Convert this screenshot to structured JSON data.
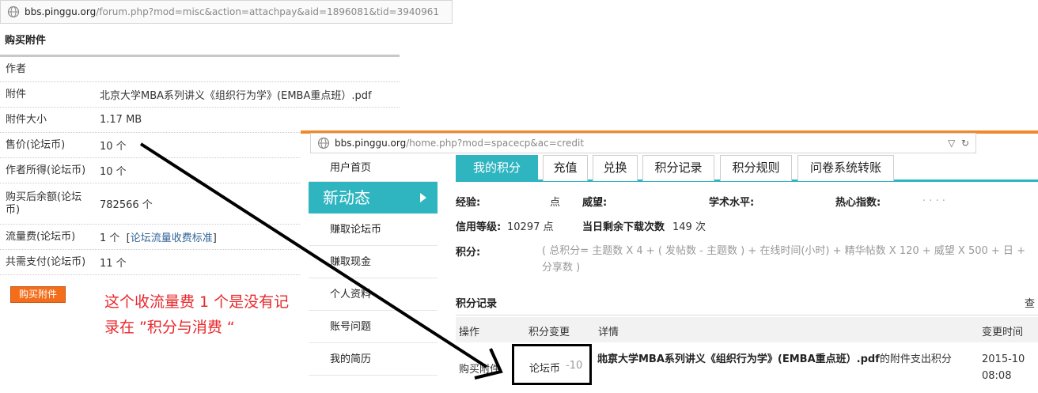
{
  "left_window": {
    "url": {
      "host": "bbs.pinggu.org",
      "path": "/forum.php?mod=misc&action=attachpay&aid=1896081&tid=3940961"
    },
    "title": "购买附件",
    "rows": [
      {
        "label": "作者",
        "value": ""
      },
      {
        "label": "附件",
        "value": "北京大学MBA系列讲义《组织行为学》(EMBA重点班）.pdf"
      },
      {
        "label": "附件大小",
        "value": "1.17 MB"
      },
      {
        "label": "售价(论坛币)",
        "value": "10 个"
      },
      {
        "label": "作者所得(论坛币)",
        "value": "10 个"
      },
      {
        "label": "购买后余额(论坛币)",
        "value": "782566 个"
      },
      {
        "label": "流量费(论坛币)",
        "value": "1 个",
        "link_text": "论坛流量收费标准"
      },
      {
        "label": "共需支付(论坛币)",
        "value": "11 个"
      }
    ],
    "buy_button": "购买附件",
    "annotation": "这个收流量费 1 个是没有记录在 ”积分与消费 “"
  },
  "right_window": {
    "url": {
      "host": "bbs.pinggu.org",
      "path": "/home.php?mod=spacecp&ac=credit"
    },
    "sidebar": [
      "用户首页",
      "新动态",
      "赚取论坛币",
      "赚取现金",
      "个人资料",
      "账号问题",
      "我的简历"
    ],
    "sidebar_active": "新动态",
    "tabs": [
      "我的积分",
      "充值",
      "兑换",
      "积分记录",
      "积分规则",
      "问卷系统转账"
    ],
    "tab_active": "我的积分",
    "stats": {
      "exp_label": "经验:",
      "exp_unit": "点",
      "prestige_label": "威望:",
      "academic_label": "学术水平:",
      "enthusiasm_label": "热心指数:",
      "credit_level_label": "信用等级:",
      "credit_level_value": "10297 点",
      "downloads_label": "当日剩余下载次数",
      "downloads_value": "149 次",
      "points_label": "积分:",
      "points_formula": "( 总积分= 主题数 X 4 + ( 发帖数 - 主题数 ) + 在线时间(小时) + 精华帖数 X 120 + 威望 X 500 + 日 + 分享数 )"
    },
    "records": {
      "title": "积分记录",
      "more": "查",
      "columns": [
        "操作",
        "积分变更",
        "详情",
        "变更时间"
      ],
      "rows": [
        {
          "action": "购买附件",
          "credit_unit": "论坛币",
          "credit_amount": "-10",
          "detail_prefix": "购买",
          "detail_bold": "北京大学MBA系列讲义《组织行为学》(EMBA重点班）.pdf",
          "detail_suffix": "的附件支出积分",
          "time_date": "2015-10",
          "time_clock": "08:08"
        }
      ]
    }
  },
  "colors": {
    "accent": "#2fb5c0",
    "buy_button": "#f36d1a",
    "annotation": "#e8282c",
    "link": "#336699"
  }
}
